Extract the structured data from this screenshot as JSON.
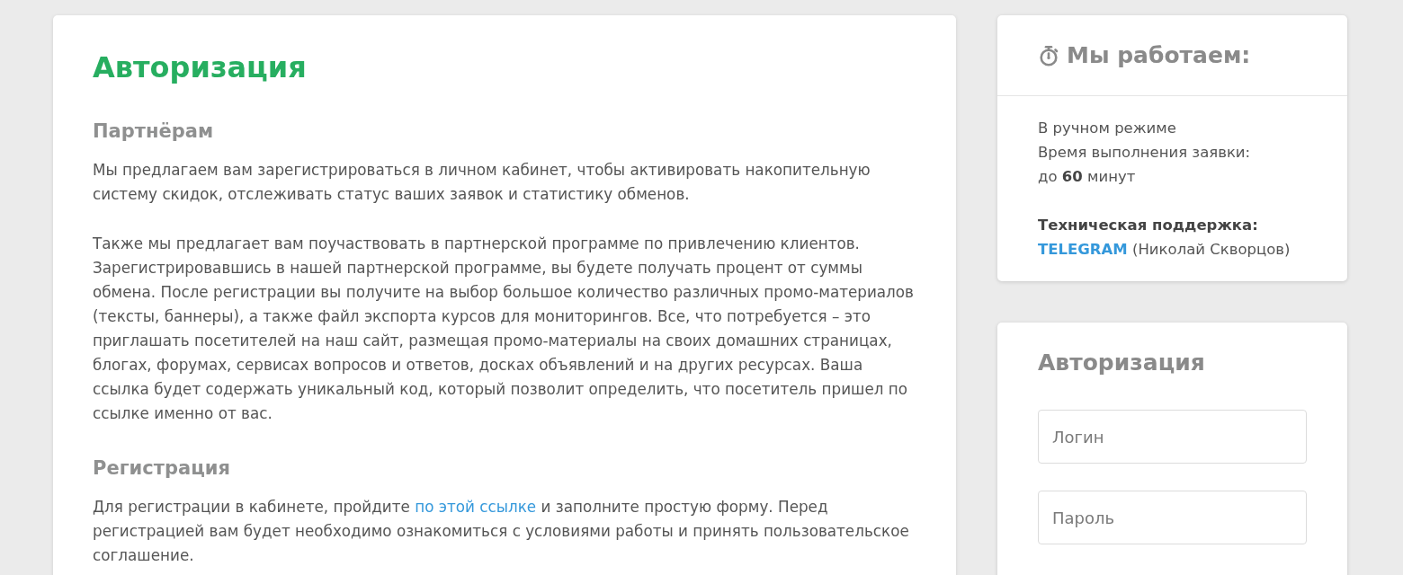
{
  "main": {
    "title": "Авторизация",
    "sections": [
      {
        "heading": "Партнёрам",
        "paragraphs": [
          [
            {
              "kind": "text",
              "text": "Мы предлагаем вам зарегистрироваться в личном кабинет, чтобы активировать накопительную систему скидок, отслеживать статус ваших заявок и статистику обменов."
            }
          ],
          [
            {
              "kind": "text",
              "text": "Также мы предлагает вам поучаствовать в партнерской программе по привлечению клиентов. Зарегистрировавшись в нашей партнерской программе, вы будете получать процент от суммы обмена. После регистрации вы получите на выбор большое количество различных промо-материалов (тексты, баннеры), а также файл экспорта курсов для мониторингов. Все, что потребуется – это приглашать посетителей на наш сайт, размещая промо-материалы на своих домашних страницах, блогах, форумах, сервисах вопросов и ответов, досках объявлений и на других ресурсах. Ваша ссылка будет содержать уникальный код, который позволит определить, что посетитель пришел по ссылке именно от вас."
            }
          ]
        ]
      },
      {
        "heading": "Регистрация",
        "paragraphs": [
          [
            {
              "kind": "text",
              "text": "Для регистрации в кабинете, пройдите "
            },
            {
              "kind": "link",
              "text": "по этой ссылке"
            },
            {
              "kind": "text",
              "text": " и заполните простую форму. Перед регистрацией вам будет необходимо ознакомиться с условиями работы и принять пользовательское соглашение."
            }
          ]
        ]
      }
    ]
  },
  "schedule": {
    "title": "Мы работаем:",
    "lines": [
      "В ручном режиме",
      "Время выполнения заявки:",
      "до **60** минут"
    ],
    "support_label": "Техническая поддержка:",
    "support_link": "TELEGRAM",
    "support_contact": "(Николай Скворцов)"
  },
  "login": {
    "title": "Авторизация",
    "fields": [
      {
        "placeholder": "Логин"
      },
      {
        "placeholder": "Пароль"
      }
    ]
  }
}
